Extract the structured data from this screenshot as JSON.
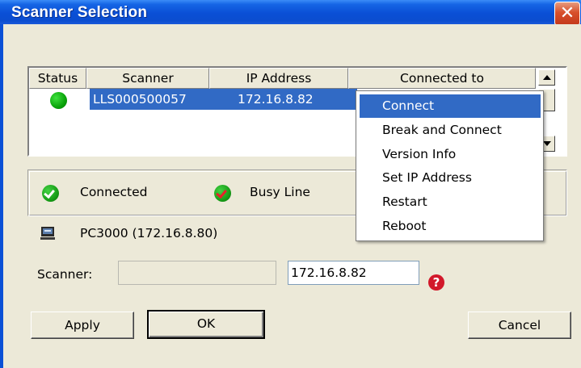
{
  "window": {
    "title": "Scanner Selection"
  },
  "list": {
    "columns": [
      "Status",
      "Scanner",
      "IP Address",
      "Connected to"
    ],
    "rows": [
      {
        "status": "connected",
        "scanner": "LLS000500057",
        "ip": "172.16.8.82",
        "connected_to": ""
      }
    ]
  },
  "legend": {
    "items": [
      {
        "label": "Connected",
        "icon": "green-check-icon"
      },
      {
        "label": "Busy Line",
        "icon": "red-check-icon"
      }
    ]
  },
  "pc": {
    "label": "PC3000 (172.16.8.80)",
    "icon": "computer-icon"
  },
  "form": {
    "scanner_label": "Scanner:",
    "scanner_name_value": "",
    "ip_value": "172.16.8.82"
  },
  "buttons": {
    "apply": "Apply",
    "ok": "OK",
    "cancel": "Cancel"
  },
  "context_menu": {
    "items": [
      "Connect",
      "Break and Connect",
      "Version Info",
      "Set IP Address",
      "Restart",
      "Reboot"
    ],
    "highlighted": 0
  },
  "colors": {
    "titlebar": "#0a4fd6",
    "dialog_bg": "#ece9d8",
    "selection": "#316ac5",
    "close": "#d8502b"
  }
}
